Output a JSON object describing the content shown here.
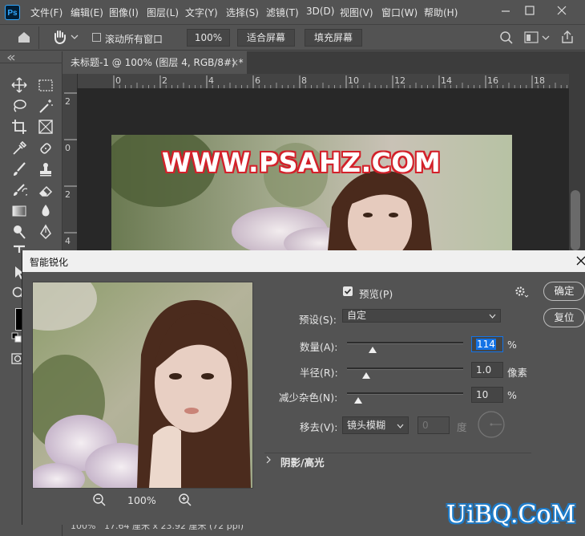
{
  "app": {
    "logo_text": "Ps"
  },
  "menu": [
    "文件(F)",
    "编辑(E)",
    "图像(I)",
    "图层(L)",
    "文字(Y)",
    "选择(S)",
    "滤镜(T)",
    "3D(D)",
    "视图(V)",
    "窗口(W)",
    "帮助(H)"
  ],
  "options_bar": {
    "scroll_all_label": "滚动所有窗口",
    "zoom_value": "100%",
    "fit_screen_label": "适合屏幕",
    "fill_screen_label": "填充屏幕"
  },
  "document_tab": {
    "title": "未标题-1 @ 100% (图层 4, RGB/8#) *",
    "close": "×"
  },
  "ruler": {
    "top_ticks": [
      "0",
      "2",
      "4",
      "6",
      "8",
      "10",
      "12",
      "14",
      "16",
      "18"
    ],
    "left_ticks": [
      "2",
      "0",
      "2",
      "4"
    ]
  },
  "canvas": {
    "watermark": "WWW.PSAHZ.COM"
  },
  "status_bar": {
    "zoom": "100%",
    "doc_size": "17.64 厘米 x 23.92 厘米 (72 ppi)"
  },
  "dialog": {
    "title": "智能锐化",
    "close": "×",
    "preview_label": "预览(P)",
    "preview_checked": true,
    "preset_label": "预设(S):",
    "preset_value": "自定",
    "amount_label": "数量(A):",
    "amount_value": "114",
    "amount_unit": "%",
    "amount_level": 0.114,
    "radius_label": "半径(R):",
    "radius_value": "1.0",
    "radius_unit": "像素",
    "noise_label": "减少杂色(N):",
    "noise_value": "10",
    "noise_unit": "%",
    "remove_label": "移去(V):",
    "remove_value": "镜头模糊",
    "angle_value": "0",
    "angle_unit": "度",
    "shadows_label": "阴影/高光",
    "ok_label": "确定",
    "reset_label": "复位",
    "preview_zoom": "100%"
  },
  "site_watermark": "UiBQ.CoM",
  "colors": {
    "accent": "#31a8ff",
    "panel": "#535353",
    "watermark_red": "#d3212a",
    "watermark_blue": "#1f7cc9"
  }
}
